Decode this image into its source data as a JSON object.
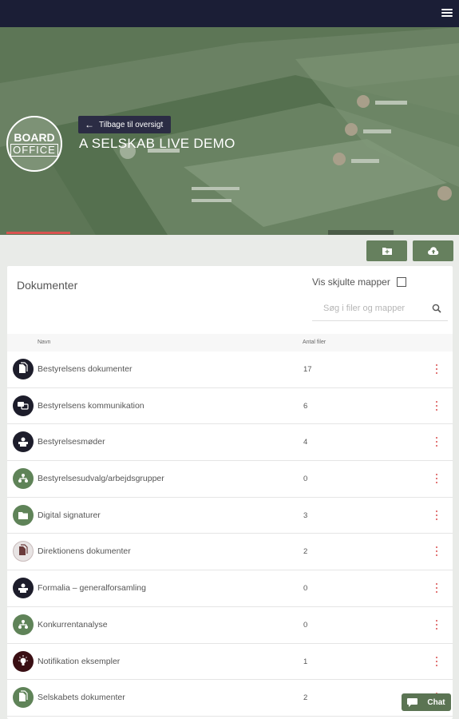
{
  "header": {
    "back_label": "Tilbage til oversigt",
    "company_name": "A SELSKAB LIVE DEMO",
    "logo_line1": "BOARD",
    "logo_line2": "OFFICE"
  },
  "tabs": [
    {
      "icon": "document-icon",
      "active": false
    },
    {
      "icon": "chat-icon",
      "active": false
    },
    {
      "icon": "calendar-icon",
      "active": false
    },
    {
      "icon": "people-icon",
      "active": false
    },
    {
      "icon": "book-icon",
      "active": false
    },
    {
      "icon": "pen-icon",
      "active": true
    },
    {
      "icon": "gear-icon",
      "active": false
    }
  ],
  "actions": {
    "new_folder_icon": "folder-plus-icon",
    "upload_icon": "cloud-upload-icon"
  },
  "documents": {
    "title": "Dokumenter",
    "show_hidden_label": "Vis skjulte mapper",
    "search_placeholder": "Søg i filer og mapper",
    "columns": {
      "name": "Navn",
      "count": "Antal filer"
    },
    "rows": [
      {
        "name": "Bestyrelsens dokumenter",
        "count": "17",
        "icon": "documents-icon",
        "color": "#1d1d2b"
      },
      {
        "name": "Bestyrelsens kommunikation",
        "count": "6",
        "icon": "chat-bubbles-icon",
        "color": "#1d1d2b"
      },
      {
        "name": "Bestyrelsesmøder",
        "count": "4",
        "icon": "meeting-icon",
        "color": "#1d1d2b"
      },
      {
        "name": "Bestyrelsesudvalg/arbejdsgrupper",
        "count": "0",
        "icon": "org-chart-icon",
        "color": "#5f8358"
      },
      {
        "name": "Digital signaturer",
        "count": "3",
        "icon": "folder-icon",
        "color": "#5f8358"
      },
      {
        "name": "Direktionens dokumenter",
        "count": "2",
        "icon": "documents-icon",
        "color": "#e8e4e4"
      },
      {
        "name": "Formalia – generalforsamling",
        "count": "0",
        "icon": "meeting-icon",
        "color": "#1d1d2b"
      },
      {
        "name": "Konkurrentanalyse",
        "count": "0",
        "icon": "org-chart-icon",
        "color": "#5f8358"
      },
      {
        "name": "Notifikation eksempler",
        "count": "1",
        "icon": "lightbulb-icon",
        "color": "#3a0f14"
      },
      {
        "name": "Selskabets dokumenter",
        "count": "2",
        "icon": "documents-icon",
        "color": "#5f8358"
      }
    ]
  },
  "chat": {
    "label": "Chat"
  }
}
